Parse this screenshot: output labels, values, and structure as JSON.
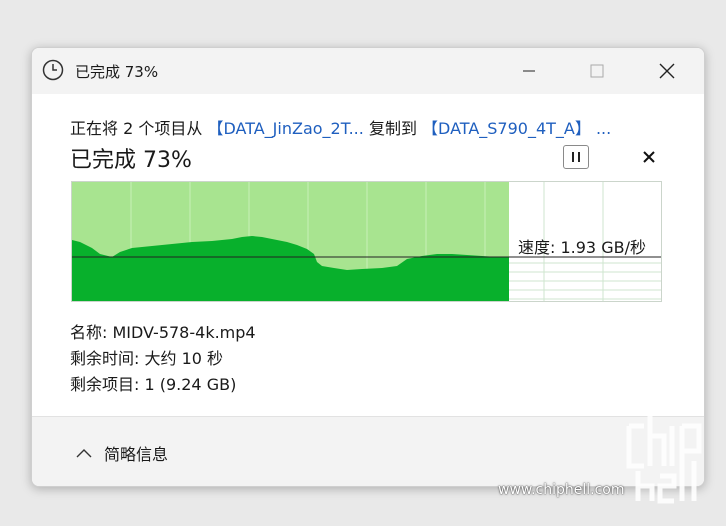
{
  "window": {
    "title": "已完成 73%"
  },
  "transfer": {
    "prefix": "正在将 2 个项目从 ",
    "source": "【DATA_JinZao_2T...",
    "middle": " 复制到 ",
    "destination": "【DATA_S790_4T_A】 ...",
    "status": "已完成 73%",
    "progress_percent": 73,
    "speed": "速度: 1.93 GB/秒"
  },
  "details": {
    "name": "名称:  MIDV-578-4k.mp4",
    "time_left": "剩余时间: 大约 10 秒",
    "items_left": "剩余项目: 1 (9.24 GB)"
  },
  "footer": {
    "more_info_label": "简略信息"
  },
  "watermark": {
    "site": "www.chiphell.com"
  },
  "colors": {
    "graph_background": "#a8e490",
    "graph_fill": "#08b02c",
    "link": "#1f5fbf"
  }
}
